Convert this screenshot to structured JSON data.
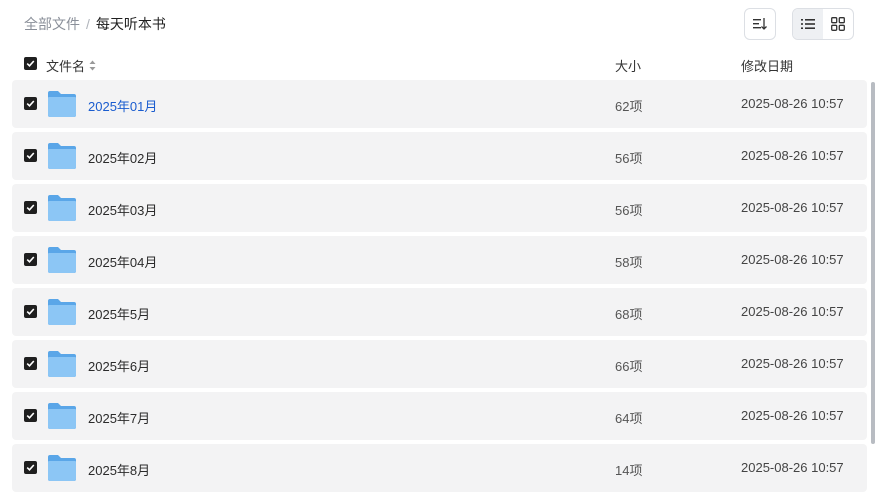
{
  "breadcrumb": {
    "root": "全部文件",
    "separator": "/",
    "current": "每天听本书"
  },
  "toolbar": {
    "sort_icon": "sort-icon",
    "list_view_icon": "list-icon",
    "grid_view_icon": "grid-icon",
    "active_view": "list"
  },
  "columns": {
    "name": "文件名",
    "size": "大小",
    "modified": "修改日期"
  },
  "rows": [
    {
      "name": "2025年01月",
      "size": "62项",
      "modified": "2025-08-26 10:57",
      "checked": true
    },
    {
      "name": "2025年02月",
      "size": "56项",
      "modified": "2025-08-26 10:57",
      "checked": true
    },
    {
      "name": "2025年03月",
      "size": "56项",
      "modified": "2025-08-26 10:57",
      "checked": true
    },
    {
      "name": "2025年04月",
      "size": "58项",
      "modified": "2025-08-26 10:57",
      "checked": true
    },
    {
      "name": "2025年5月",
      "size": "68项",
      "modified": "2025-08-26 10:57",
      "checked": true
    },
    {
      "name": "2025年6月",
      "size": "66项",
      "modified": "2025-08-26 10:57",
      "checked": true
    },
    {
      "name": "2025年7月",
      "size": "64项",
      "modified": "2025-08-26 10:57",
      "checked": true
    },
    {
      "name": "2025年8月",
      "size": "14项",
      "modified": "2025-08-26 10:57",
      "checked": true
    }
  ],
  "colors": {
    "link": "#1a5ccf",
    "row_bg": "#f3f3f4",
    "folder": "#6fb4ee"
  }
}
